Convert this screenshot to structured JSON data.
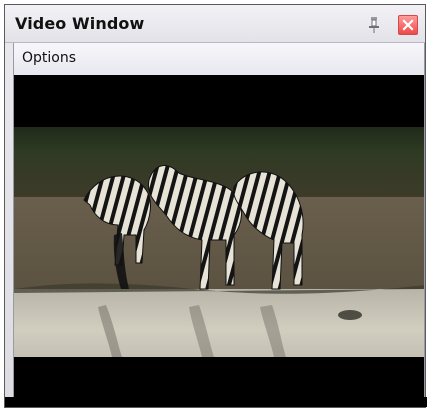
{
  "window": {
    "title": "Video Window",
    "pin_icon": "pin-icon",
    "close_icon": "close-icon"
  },
  "menu": {
    "options_label": "Options"
  },
  "video": {
    "content": "zebra-scene"
  },
  "colors": {
    "close_button": "#ee4a4a",
    "video_background": "#000000"
  }
}
